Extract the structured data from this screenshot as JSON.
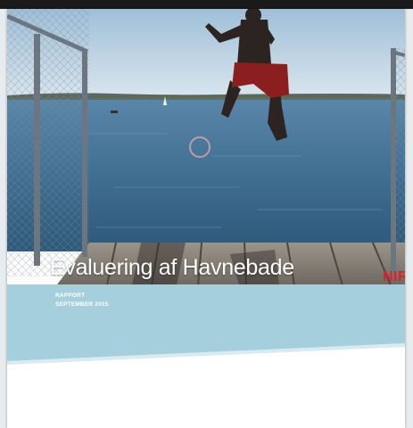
{
  "document": {
    "title": "Evaluering af Havnebade",
    "report_type": "RAPPORT",
    "date": "SEPTEMBER 2015",
    "logo_text": "NIR"
  },
  "colors": {
    "band": "#a5cfdc",
    "water": "#3f6f92",
    "sky": "#b9d2e3",
    "logo": "#d8232a"
  },
  "cover_image": "Boy jumping from a wooden pier into the harbour water"
}
